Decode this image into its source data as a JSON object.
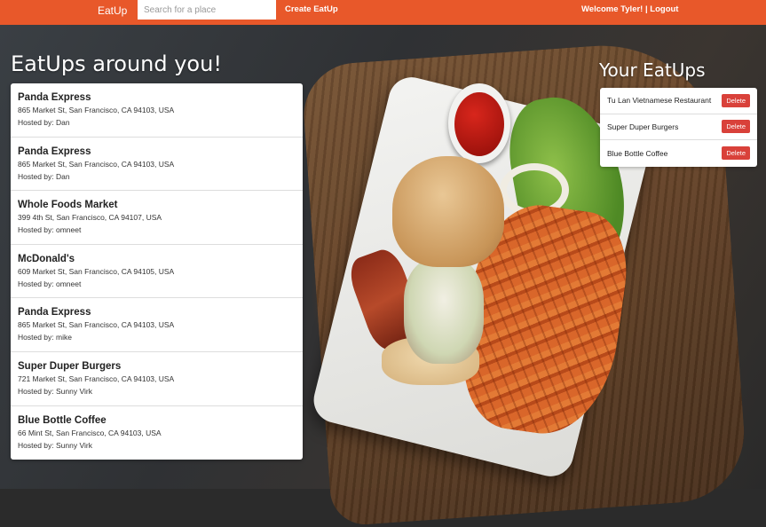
{
  "navbar": {
    "brand": "EatUp",
    "search_placeholder": "Search for a place",
    "create_link": "Create EatUp",
    "welcome": "Welcome Tyler!",
    "separator": " | ",
    "logout": "Logout"
  },
  "around": {
    "heading": "EatUps around you!",
    "items": [
      {
        "name": "Panda Express",
        "address": "865 Market St, San Francisco, CA 94103, USA",
        "host": "Hosted by: Dan"
      },
      {
        "name": "Panda Express",
        "address": "865 Market St, San Francisco, CA 94103, USA",
        "host": "Hosted by: Dan"
      },
      {
        "name": "Whole Foods Market",
        "address": "399 4th St, San Francisco, CA 94107, USA",
        "host": "Hosted by: omneet"
      },
      {
        "name": "McDonald's",
        "address": "609 Market St, San Francisco, CA 94105, USA",
        "host": "Hosted by: omneet"
      },
      {
        "name": "Panda Express",
        "address": "865 Market St, San Francisco, CA 94103, USA",
        "host": "Hosted by: mike"
      },
      {
        "name": "Super Duper Burgers",
        "address": "721 Market St, San Francisco, CA 94103, USA",
        "host": "Hosted by: Sunny Virk"
      },
      {
        "name": "Blue Bottle Coffee",
        "address": "66 Mint St, San Francisco, CA 94103, USA",
        "host": "Hosted by: Sunny Virk"
      }
    ]
  },
  "yours": {
    "heading": "Your EatUps",
    "delete_label": "Delete",
    "items": [
      {
        "name": "Tu Lan Vietnamese Restaurant"
      },
      {
        "name": "Super Duper Burgers"
      },
      {
        "name": "Blue Bottle Coffee"
      }
    ]
  },
  "colors": {
    "navbar": "#e8582a",
    "delete_button": "#d9413a"
  }
}
